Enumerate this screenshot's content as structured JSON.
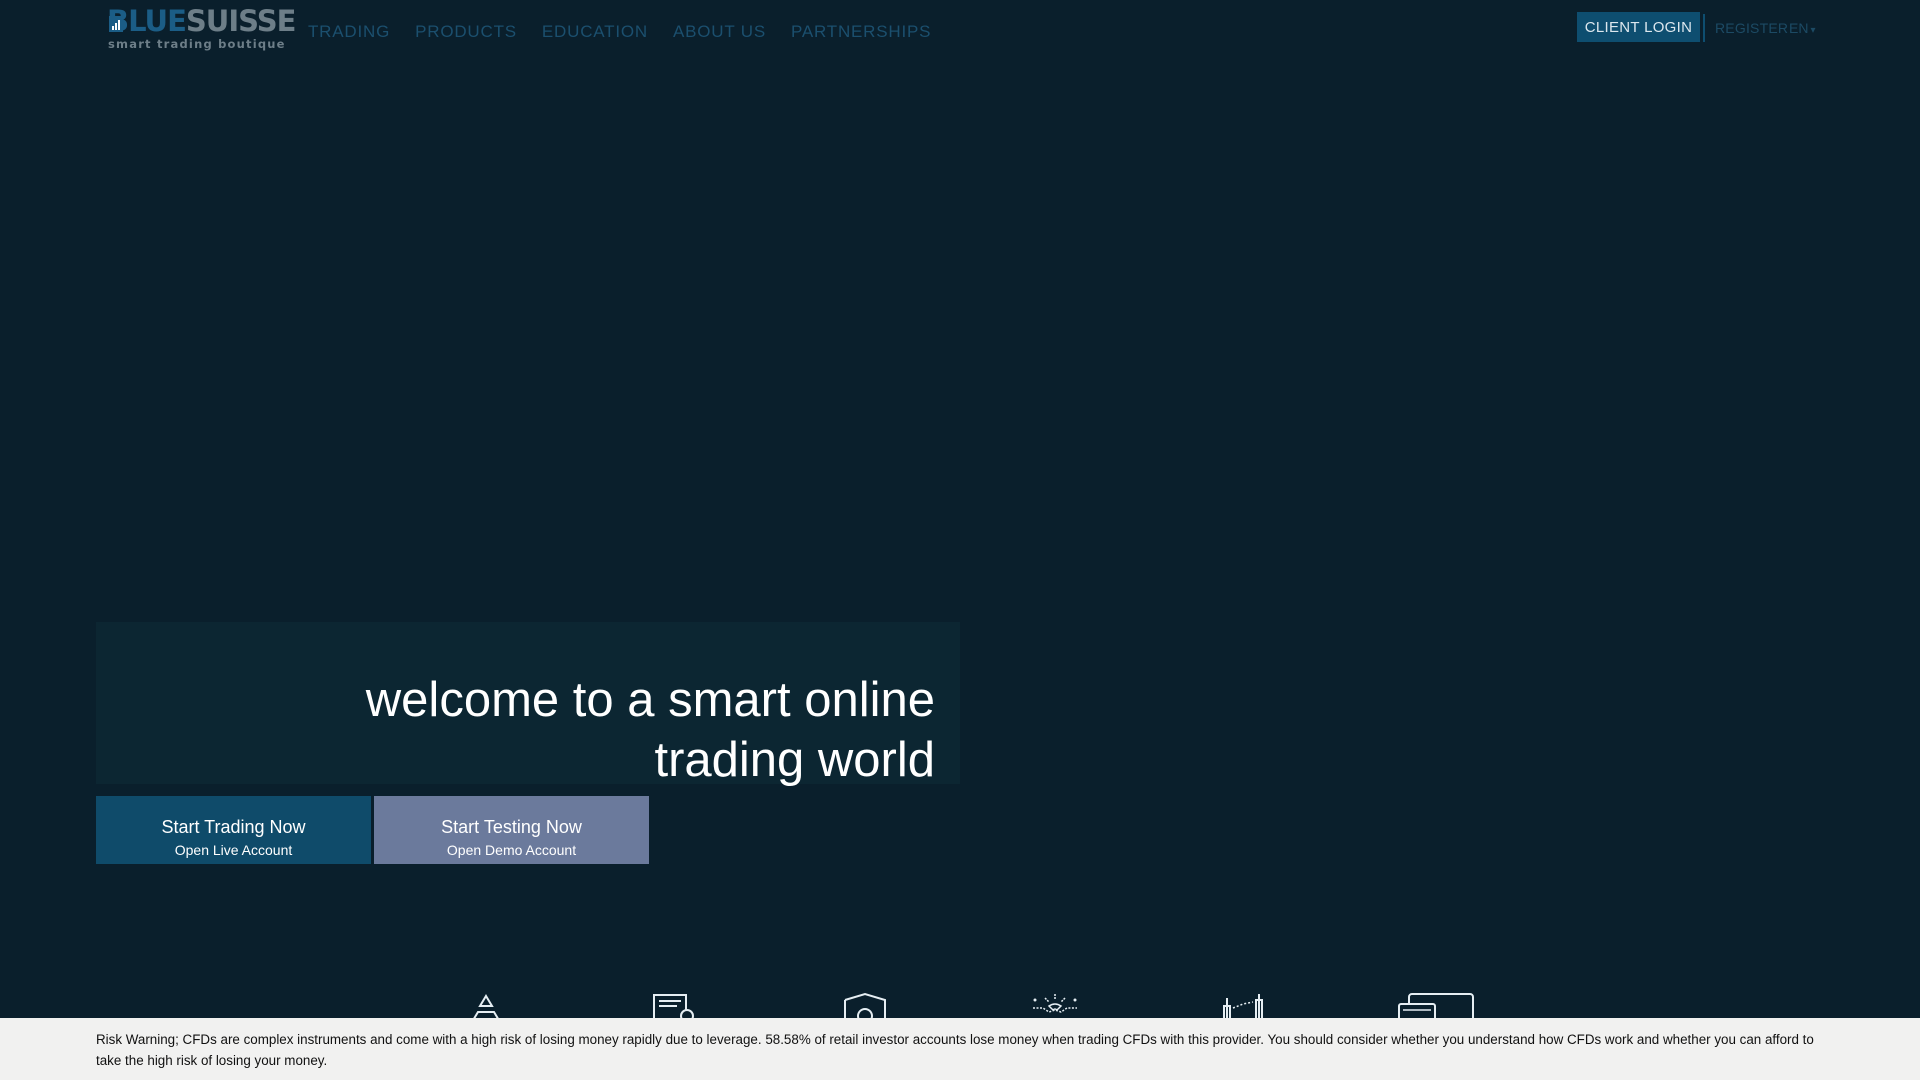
{
  "header": {
    "logo": {
      "word_blue": "BLUE",
      "word_gray": "SUISSE",
      "tagline": "smart trading boutique"
    },
    "nav": [
      {
        "label": "TRADING"
      },
      {
        "label": "PRODUCTS"
      },
      {
        "label": "EDUCATION"
      },
      {
        "label": "ABOUT US"
      },
      {
        "label": "PARTNERSHIPS"
      }
    ],
    "client_login": "CLIENT LOGIN",
    "register": "REGISTER",
    "language": "EN"
  },
  "hero": {
    "title_line1": "welcome to a smart online",
    "title_line2": "trading world",
    "cta_live": {
      "main": "Start Trading Now",
      "sub": "Open Live Account"
    },
    "cta_demo": {
      "main": "Start Testing Now",
      "sub": "Open Demo Account"
    }
  },
  "feature_icons": [
    "pyramid-icon",
    "document-search-icon",
    "shield-icon",
    "handshake-icon",
    "candlestick-chart-icon",
    "monitor-icon"
  ],
  "risk_warning": "Risk Warning; CFDs are complex instruments and come with a high risk of losing money rapidly due to leverage. 58.58% of retail investor accounts lose money when trading CFDs with this provider. You should consider whether you understand how CFDs work and whether you can afford to take the high risk of losing your money.",
  "colors": {
    "background": "#0a1f2c",
    "primary": "#0f4b6a",
    "demo_button": "#6b7a9c",
    "nav_text": "#1b4f6e",
    "risk_bar": "#f1f1f0"
  }
}
